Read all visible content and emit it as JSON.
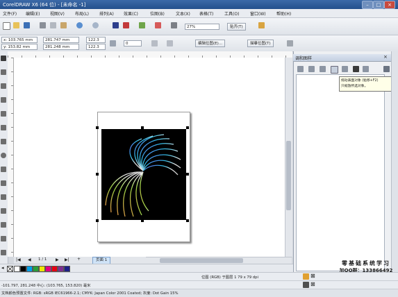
{
  "window": {
    "title": "CorelDRAW X6 (64 位) - [未命名 -1]",
    "controls": [
      "–",
      "□",
      "×"
    ]
  },
  "menu": [
    "文件(F)",
    "编辑(E)",
    "视图(V)",
    "布局(L)",
    "排列(A)",
    "效果(C)",
    "位图(B)",
    "文本(X)",
    "表格(T)",
    "工具(O)",
    "窗口(W)",
    "帮助(H)"
  ],
  "standard_toolbar": {
    "zoom": "27%",
    "snap": "贴齐(T)"
  },
  "property_bar": {
    "x": "x: 103.765 mm",
    "y": "y: 153.82 mm",
    "width": "281.747 mm",
    "height": "281.248 mm",
    "scale_w": "122.3",
    "scale_h": "122.3",
    "rotation": "0",
    "edit_bitmap": "编辑位图(E)...",
    "trace_bitmap": "描摹位图(T)"
  },
  "docker": {
    "title": "调和图样",
    "tooltip_line1": "拖动表面对象 (粘移+F2)",
    "tooltip_line2": "只缩放所选对象。"
  },
  "page_nav": {
    "counter": "1 / 1",
    "tab": "页面 1"
  },
  "palette": {
    "colors": [
      "#ffffff",
      "#000000",
      "#00a0e9",
      "#2a9d3a",
      "#f0e500",
      "#e4007f",
      "#e60012",
      "#7d2e90",
      "#1d2088"
    ]
  },
  "status": {
    "line1": "位图 (RGB) 于图层 1 79 x 79 dpi",
    "line2": "-101.797, 281.248 中心: (103.765, 153.820) 毫米",
    "line3": "文档颜色预置文件: RGB: sRGB IEC61966-2.1; CMYK: Japan Color 2001 Coated; 灰度: Dot Gain 15%"
  },
  "watermark": {
    "line1": "零基础系统学习",
    "line2": "加QQ群：133866492"
  }
}
